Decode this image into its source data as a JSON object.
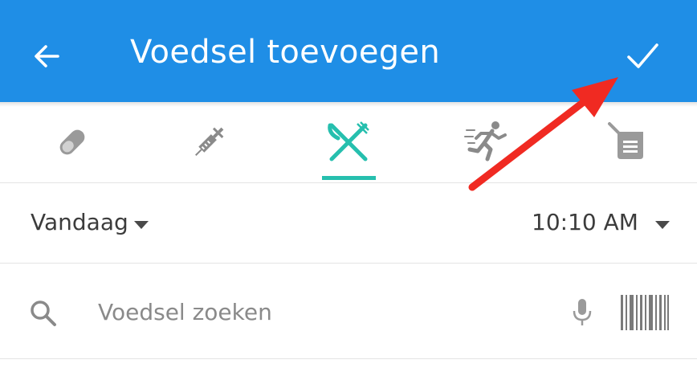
{
  "appbar": {
    "title": "Voedsel toevoegen",
    "back_icon": "arrow-left-icon",
    "confirm_icon": "checkmark-icon",
    "background": "#1f8ee6"
  },
  "tabs": [
    {
      "icon": "pill-icon",
      "active": false
    },
    {
      "icon": "syringe-icon",
      "active": false
    },
    {
      "icon": "fork-knife-icon",
      "active": true
    },
    {
      "icon": "running-icon",
      "active": false
    },
    {
      "icon": "note-icon",
      "active": false
    }
  ],
  "accent_color": "#26bfae",
  "date_row": {
    "date": "Vandaag",
    "time": "10:10 AM"
  },
  "search": {
    "placeholder": "Voedsel zoeken",
    "value": "",
    "mic_icon": "microphone-icon",
    "barcode_icon": "barcode-icon"
  },
  "annotation": {
    "color": "#f02a22"
  }
}
